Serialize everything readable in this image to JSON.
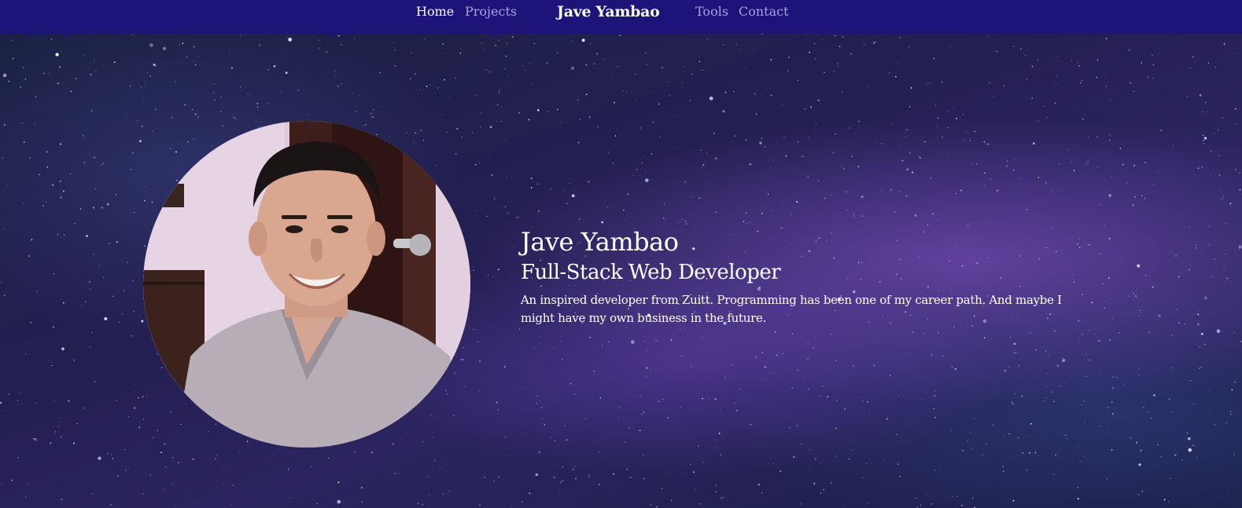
{
  "nav": {
    "home_label": "Home",
    "projects_label": "Projects",
    "brand": "Jave Yambao",
    "tools_label": "Tools",
    "contact_label": "Contact"
  },
  "hero": {
    "name": "Jave Yambao",
    "role": "Full-Stack Web Developer",
    "description": "An inspired developer from Zuitt. Programming has been one of my career path. And maybe I might have my own business in the future."
  },
  "colors": {
    "navbar_bg": "#1d1479",
    "nav_link": "#a9a3dc",
    "nav_active": "#ffffff",
    "hero_text": "#ffffff"
  }
}
